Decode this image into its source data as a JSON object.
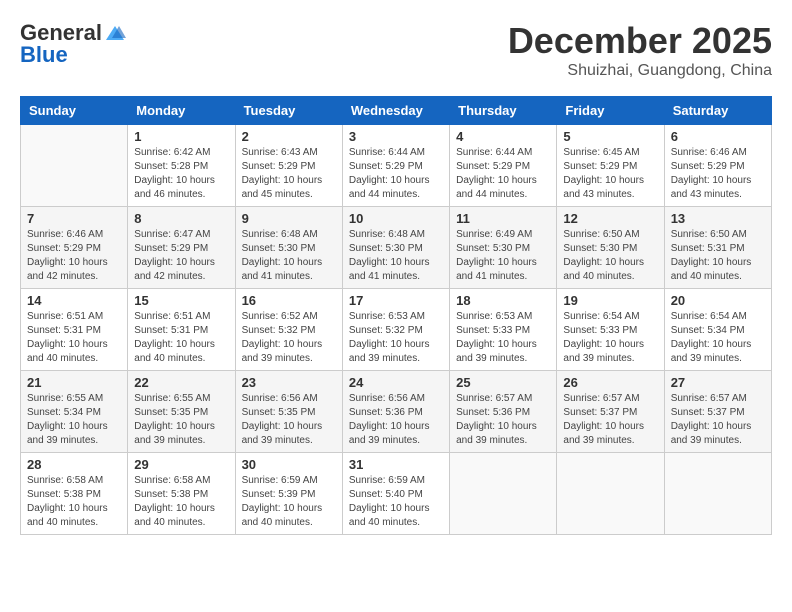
{
  "logo": {
    "general": "General",
    "blue": "Blue"
  },
  "header": {
    "month": "December 2025",
    "location": "Shuizhai, Guangdong, China"
  },
  "weekdays": [
    "Sunday",
    "Monday",
    "Tuesday",
    "Wednesday",
    "Thursday",
    "Friday",
    "Saturday"
  ],
  "weeks": [
    [
      {
        "day": "",
        "info": ""
      },
      {
        "day": "1",
        "info": "Sunrise: 6:42 AM\nSunset: 5:28 PM\nDaylight: 10 hours\nand 46 minutes."
      },
      {
        "day": "2",
        "info": "Sunrise: 6:43 AM\nSunset: 5:29 PM\nDaylight: 10 hours\nand 45 minutes."
      },
      {
        "day": "3",
        "info": "Sunrise: 6:44 AM\nSunset: 5:29 PM\nDaylight: 10 hours\nand 44 minutes."
      },
      {
        "day": "4",
        "info": "Sunrise: 6:44 AM\nSunset: 5:29 PM\nDaylight: 10 hours\nand 44 minutes."
      },
      {
        "day": "5",
        "info": "Sunrise: 6:45 AM\nSunset: 5:29 PM\nDaylight: 10 hours\nand 43 minutes."
      },
      {
        "day": "6",
        "info": "Sunrise: 6:46 AM\nSunset: 5:29 PM\nDaylight: 10 hours\nand 43 minutes."
      }
    ],
    [
      {
        "day": "7",
        "info": "Sunrise: 6:46 AM\nSunset: 5:29 PM\nDaylight: 10 hours\nand 42 minutes."
      },
      {
        "day": "8",
        "info": "Sunrise: 6:47 AM\nSunset: 5:29 PM\nDaylight: 10 hours\nand 42 minutes."
      },
      {
        "day": "9",
        "info": "Sunrise: 6:48 AM\nSunset: 5:30 PM\nDaylight: 10 hours\nand 41 minutes."
      },
      {
        "day": "10",
        "info": "Sunrise: 6:48 AM\nSunset: 5:30 PM\nDaylight: 10 hours\nand 41 minutes."
      },
      {
        "day": "11",
        "info": "Sunrise: 6:49 AM\nSunset: 5:30 PM\nDaylight: 10 hours\nand 41 minutes."
      },
      {
        "day": "12",
        "info": "Sunrise: 6:50 AM\nSunset: 5:30 PM\nDaylight: 10 hours\nand 40 minutes."
      },
      {
        "day": "13",
        "info": "Sunrise: 6:50 AM\nSunset: 5:31 PM\nDaylight: 10 hours\nand 40 minutes."
      }
    ],
    [
      {
        "day": "14",
        "info": "Sunrise: 6:51 AM\nSunset: 5:31 PM\nDaylight: 10 hours\nand 40 minutes."
      },
      {
        "day": "15",
        "info": "Sunrise: 6:51 AM\nSunset: 5:31 PM\nDaylight: 10 hours\nand 40 minutes."
      },
      {
        "day": "16",
        "info": "Sunrise: 6:52 AM\nSunset: 5:32 PM\nDaylight: 10 hours\nand 39 minutes."
      },
      {
        "day": "17",
        "info": "Sunrise: 6:53 AM\nSunset: 5:32 PM\nDaylight: 10 hours\nand 39 minutes."
      },
      {
        "day": "18",
        "info": "Sunrise: 6:53 AM\nSunset: 5:33 PM\nDaylight: 10 hours\nand 39 minutes."
      },
      {
        "day": "19",
        "info": "Sunrise: 6:54 AM\nSunset: 5:33 PM\nDaylight: 10 hours\nand 39 minutes."
      },
      {
        "day": "20",
        "info": "Sunrise: 6:54 AM\nSunset: 5:34 PM\nDaylight: 10 hours\nand 39 minutes."
      }
    ],
    [
      {
        "day": "21",
        "info": "Sunrise: 6:55 AM\nSunset: 5:34 PM\nDaylight: 10 hours\nand 39 minutes."
      },
      {
        "day": "22",
        "info": "Sunrise: 6:55 AM\nSunset: 5:35 PM\nDaylight: 10 hours\nand 39 minutes."
      },
      {
        "day": "23",
        "info": "Sunrise: 6:56 AM\nSunset: 5:35 PM\nDaylight: 10 hours\nand 39 minutes."
      },
      {
        "day": "24",
        "info": "Sunrise: 6:56 AM\nSunset: 5:36 PM\nDaylight: 10 hours\nand 39 minutes."
      },
      {
        "day": "25",
        "info": "Sunrise: 6:57 AM\nSunset: 5:36 PM\nDaylight: 10 hours\nand 39 minutes."
      },
      {
        "day": "26",
        "info": "Sunrise: 6:57 AM\nSunset: 5:37 PM\nDaylight: 10 hours\nand 39 minutes."
      },
      {
        "day": "27",
        "info": "Sunrise: 6:57 AM\nSunset: 5:37 PM\nDaylight: 10 hours\nand 39 minutes."
      }
    ],
    [
      {
        "day": "28",
        "info": "Sunrise: 6:58 AM\nSunset: 5:38 PM\nDaylight: 10 hours\nand 40 minutes."
      },
      {
        "day": "29",
        "info": "Sunrise: 6:58 AM\nSunset: 5:38 PM\nDaylight: 10 hours\nand 40 minutes."
      },
      {
        "day": "30",
        "info": "Sunrise: 6:59 AM\nSunset: 5:39 PM\nDaylight: 10 hours\nand 40 minutes."
      },
      {
        "day": "31",
        "info": "Sunrise: 6:59 AM\nSunset: 5:40 PM\nDaylight: 10 hours\nand 40 minutes."
      },
      {
        "day": "",
        "info": ""
      },
      {
        "day": "",
        "info": ""
      },
      {
        "day": "",
        "info": ""
      }
    ]
  ]
}
